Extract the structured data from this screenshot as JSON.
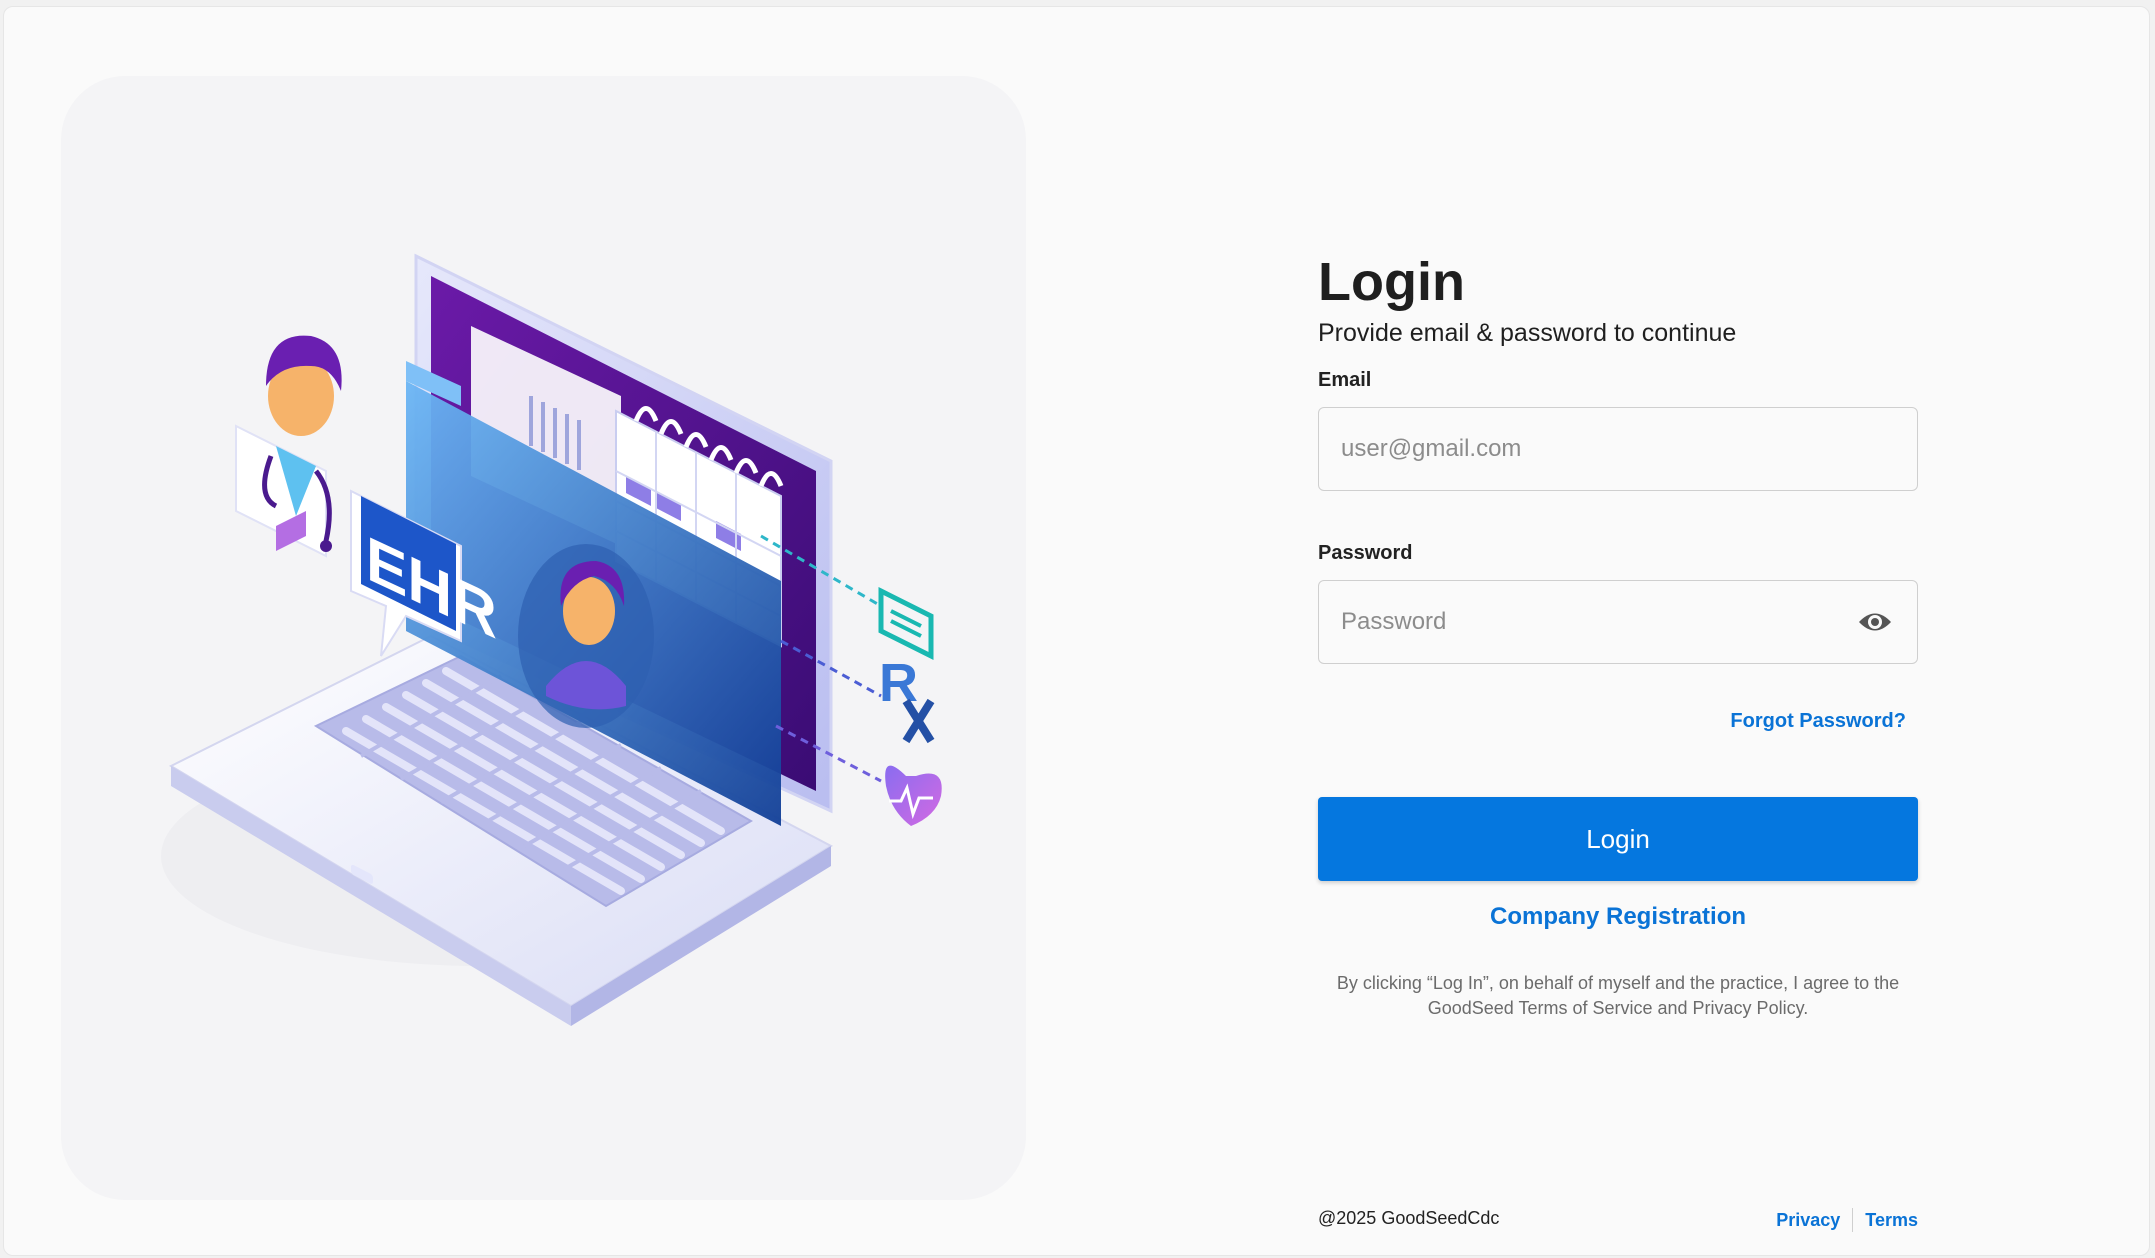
{
  "hero": {
    "badge_text": "EHR",
    "rx_text": "R"
  },
  "login": {
    "title": "Login",
    "subtitle": "Provide email & password to continue",
    "email_label": "Email",
    "email_placeholder": "user@gmail.com",
    "password_label": "Password",
    "password_placeholder": "Password",
    "forgot_password": "Forgot Password?",
    "login_button": "Login",
    "company_registration": "Company Registration",
    "terms_notice": "By clicking “Log In”, on behalf of myself and the practice, I agree to the GoodSeed Terms of Service and Privacy Policy."
  },
  "footer": {
    "copyright": "@2025 GoodSeedCdc",
    "privacy": "Privacy",
    "terms": "Terms"
  },
  "colors": {
    "primary": "#0577df",
    "link": "#0a73d6"
  },
  "icons": {
    "password_toggle": "eye-icon"
  }
}
